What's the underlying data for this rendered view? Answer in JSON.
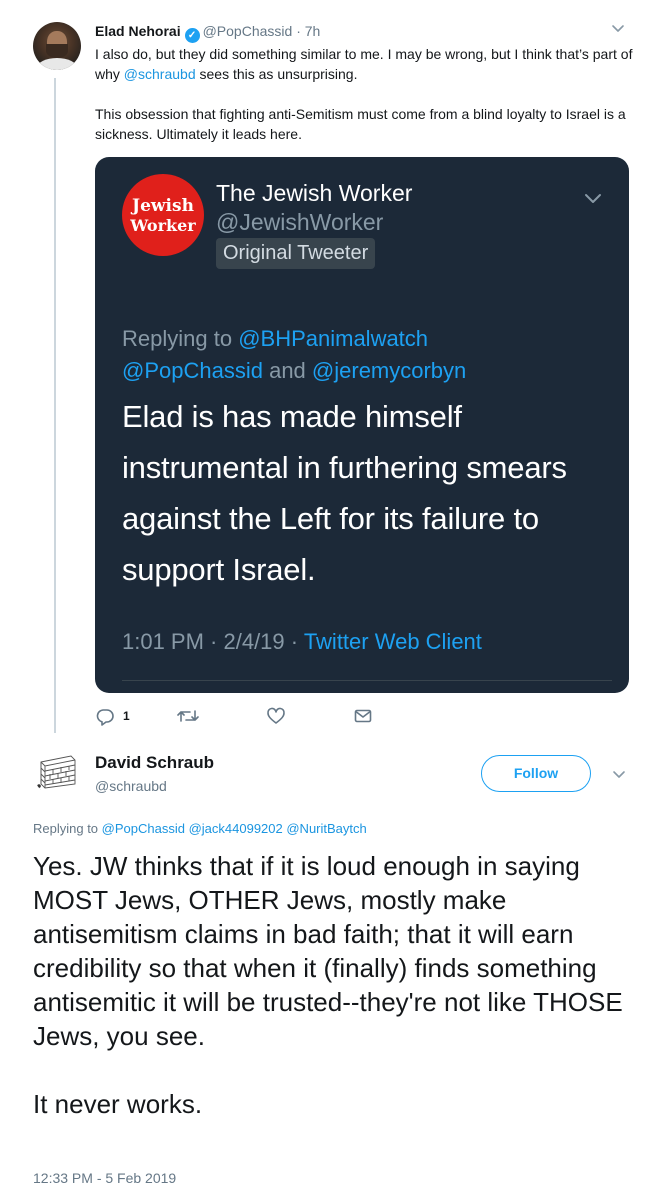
{
  "tweet1": {
    "name": "Elad Nehorai",
    "verified_mark": "✓",
    "handle": "@PopChassid",
    "separator": "·",
    "age": "7h",
    "body_p1_before": "I also do, but they did something similar to me. I may be wrong, but I think that’s part of why ",
    "body_p1_mention": "@schraubd",
    "body_p1_after": " sees this as unsurprising.",
    "body_p2": "This obsession that fighting anti-Semitism must come from a blind loyalty to Israel is a sickness. Ultimately it leads here.",
    "actions": {
      "reply_count": "1"
    },
    "icons": {
      "reply": "reply-icon",
      "retweet": "retweet-icon",
      "like": "heart-icon",
      "dm": "envelope-icon",
      "menu": "chevron-down-icon"
    }
  },
  "quoted": {
    "avatar_line1": "Jewish",
    "avatar_line2": "Worker",
    "name": "The Jewish Worker",
    "handle": "@JewishWorker",
    "badge": "Original Tweeter",
    "replying_prefix": "Replying to ",
    "replying_m1": "@BHPanimalwatch",
    "replying_m2": "@PopChassid",
    "replying_and": " and ",
    "replying_m3": "@jeremycorbyn",
    "text": "Elad is has made himself instrumental in furthering smears against the Left for its failure to support Israel.",
    "time": "1:01 PM · 2/4/19 · ",
    "client": "Twitter Web Client",
    "colors": {
      "background": "#1c2938",
      "accent": "#1da1f2",
      "avatar_bg": "#e0201b"
    }
  },
  "tweet2": {
    "name": "David Schraub",
    "handle": "@schraubd",
    "follow_label": "Follow",
    "replying_prefix": "Replying to ",
    "replying_m1": "@PopChassid",
    "replying_m2": "@jack44099202",
    "replying_m3": "@NuritBaytch",
    "body_p1": "Yes. JW thinks that if it is loud enough in saying MOST Jews, OTHER Jews, mostly make antisemitism claims in bad faith; that it will earn credibility so that when it (finally) finds something antisemitic it will be trusted--they're not like THOSE Jews, you see.",
    "body_p2": "It never works.",
    "timestamp": "12:33 PM - 5 Feb 2019",
    "colors": {
      "link": "#1b95e0",
      "follow_border": "#1da1f2"
    }
  }
}
